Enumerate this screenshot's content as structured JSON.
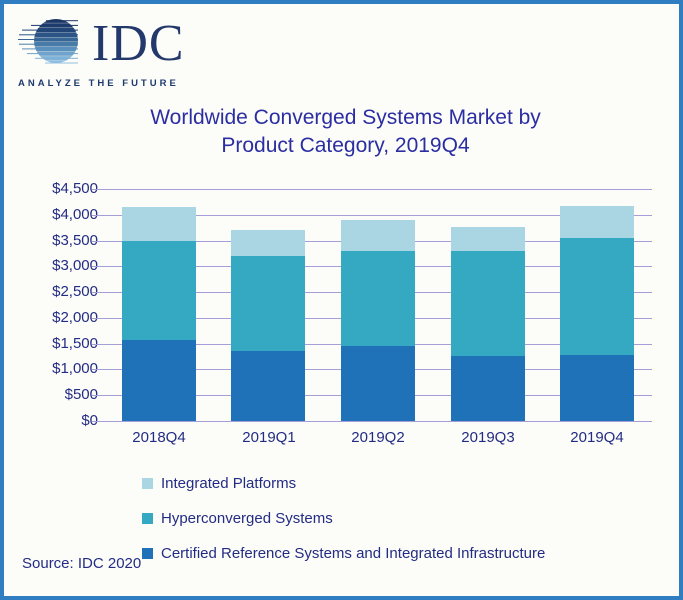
{
  "logo": {
    "brand": "IDC",
    "tagline": "ANALYZE THE FUTURE"
  },
  "title": {
    "line1": "Worldwide Converged Systems Market by",
    "line2": "Product Category, 2019Q4"
  },
  "source": "Source: IDC 2020",
  "colors": {
    "border": "#2F7EC2",
    "background": "#FCFCF8",
    "gridline": "#A49FD6",
    "axis_text": "#232C84",
    "title_text": "#2B2EA2",
    "bar_blue": "#1F72B8",
    "bar_teal": "#35A9C1",
    "bar_light_blue": "#A9D6E2",
    "logo_navy": "#1E3A6E"
  },
  "chart_data": {
    "type": "bar",
    "stacked": true,
    "title": "Worldwide Converged Systems Market by Product Category, 2019Q4",
    "categories": [
      "2018Q4",
      "2019Q1",
      "2019Q2",
      "2019Q3",
      "2019Q4"
    ],
    "series": [
      {
        "name": "Certified Reference Systems and Integrated Infrastructure",
        "color": "#1F72B8",
        "values": [
          1580,
          1355,
          1455,
          1260,
          1290
        ]
      },
      {
        "name": "Hyperconverged Systems",
        "color": "#35A9C1",
        "values": [
          1920,
          1845,
          1835,
          2045,
          2255
        ]
      },
      {
        "name": "Integrated Platforms",
        "color": "#A9D6E2",
        "values": [
          645,
          505,
          610,
          465,
          620
        ]
      }
    ],
    "stack_totals": [
      4145,
      3705,
      3900,
      3770,
      4165
    ],
    "xlabel": "",
    "ylabel": "",
    "y_unit": "US$ millions",
    "ylim": [
      0,
      4500
    ],
    "y_tick_step": 500,
    "y_ticks_top_to_bottom": [
      "$4,500",
      "$4,000",
      "$3,500",
      "$3,000",
      "$2,500",
      "$2,000",
      "$1,500",
      "$1,000",
      "$500",
      "$0"
    ],
    "grid": true,
    "legend_position": "bottom-left",
    "legend": [
      {
        "label": "Integrated Platforms",
        "color": "#A9D6E2"
      },
      {
        "label": "Hyperconverged Systems",
        "color": "#35A9C1"
      },
      {
        "label": "Certified Reference Systems and Integrated Infrastructure",
        "color": "#1F72B8"
      }
    ]
  }
}
